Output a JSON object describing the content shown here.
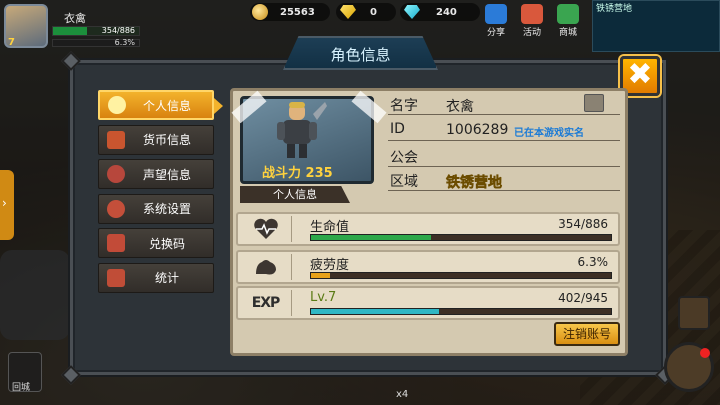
{
  "hud": {
    "player_name": "衣禽",
    "level": "7",
    "hp_text": "354/886",
    "exp_text": "6.3%",
    "coins": "25563",
    "gems": "0",
    "diamonds": "240",
    "icons": [
      {
        "name": "share-icon",
        "label": "分享",
        "color": "#2b7bd8"
      },
      {
        "name": "activity-icon",
        "label": "活动",
        "color": "#d9583c"
      },
      {
        "name": "shop-icon",
        "label": "商城",
        "color": "#3aa550"
      }
    ],
    "minimap_label": "铁锈营地"
  },
  "panel": {
    "title": "角色信息",
    "close_label": "✖"
  },
  "menu": [
    {
      "id": "personal",
      "label": "个人信息",
      "active": true,
      "icon": "user-icon"
    },
    {
      "id": "currency",
      "label": "货币信息",
      "active": false,
      "icon": "coins-icon"
    },
    {
      "id": "reputation",
      "label": "声望信息",
      "active": false,
      "icon": "reputation-icon"
    },
    {
      "id": "settings",
      "label": "系统设置",
      "active": false,
      "icon": "gear-icon"
    },
    {
      "id": "redeem",
      "label": "兑换码",
      "active": false,
      "icon": "redeem-icon"
    },
    {
      "id": "stats",
      "label": "统计",
      "active": false,
      "icon": "chart-icon"
    }
  ],
  "profile": {
    "power_label": "战斗力",
    "power_value": "235",
    "portrait_label": "个人信息",
    "name_key": "名字",
    "name_value": "衣禽",
    "id_key": "ID",
    "id_value": "1006289",
    "server_tag": "已在本游戏实名",
    "guild_key": "公会",
    "guild_value": "",
    "region_key": "区域",
    "region_value": "铁锈营地"
  },
  "stats": {
    "hp": {
      "label": "生命值",
      "value_text": "354/886",
      "fraction": 0.3995,
      "color": "#2da84a",
      "icon": "heart-icon"
    },
    "fatigue": {
      "label": "疲劳度",
      "value_text": "6.3%",
      "fraction": 0.063,
      "color": "#e8a21a",
      "icon": "muscle-icon"
    },
    "exp": {
      "icon_text": "EXP",
      "label": "Lv.7",
      "value_text": "402/945",
      "fraction": 0.4254,
      "color": "#2fb7c4"
    }
  },
  "logout_label": "注销账号",
  "bottom": {
    "home_label": "回城",
    "count": "x4"
  }
}
